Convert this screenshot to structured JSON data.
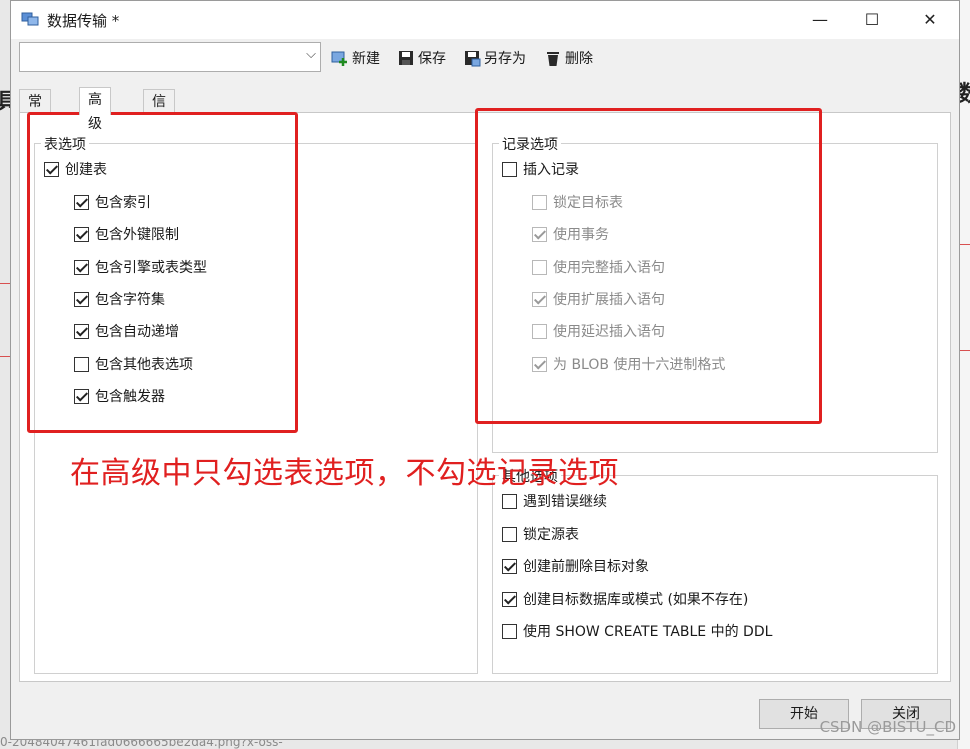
{
  "window": {
    "title": "数据传输 *",
    "minimize": "—",
    "maximize": "☐",
    "close": "✕"
  },
  "toolbar": {
    "profile_value": "",
    "new_label": "新建",
    "save_label": "保存",
    "saveas_label": "另存为",
    "delete_label": "删除"
  },
  "tabs": [
    {
      "label": "常规",
      "active": false
    },
    {
      "label": "高级",
      "active": true
    },
    {
      "label": "信息日志",
      "active": false
    }
  ],
  "table_options": {
    "title": "表选项",
    "create_table": {
      "label": "创建表",
      "checked": true
    },
    "items": [
      {
        "label": "包含索引",
        "checked": true
      },
      {
        "label": "包含外键限制",
        "checked": true
      },
      {
        "label": "包含引擎或表类型",
        "checked": true
      },
      {
        "label": "包含字符集",
        "checked": true
      },
      {
        "label": "包含自动递增",
        "checked": true
      },
      {
        "label": "包含其他表选项",
        "checked": false
      },
      {
        "label": "包含触发器",
        "checked": true
      }
    ]
  },
  "record_options": {
    "title": "记录选项",
    "insert_records": {
      "label": "插入记录",
      "checked": false
    },
    "items": [
      {
        "label": "锁定目标表",
        "checked": false
      },
      {
        "label": "使用事务",
        "checked": true
      },
      {
        "label": "使用完整插入语句",
        "checked": false
      },
      {
        "label": "使用扩展插入语句",
        "checked": true
      },
      {
        "label": "使用延迟插入语句",
        "checked": false
      },
      {
        "label": "为 BLOB 使用十六进制格式",
        "checked": true
      }
    ]
  },
  "other_options": {
    "title": "其他选项",
    "items": [
      {
        "label": "遇到错误继续",
        "checked": false
      },
      {
        "label": "锁定源表",
        "checked": false
      },
      {
        "label": "创建前删除目标对象",
        "checked": true
      },
      {
        "label": "创建目标数据库或模式 (如果不存在)",
        "checked": true
      },
      {
        "label": "使用 SHOW CREATE TABLE 中的 DDL",
        "checked": false
      }
    ]
  },
  "annotation": "在高级中只勾选表选项，不勾选记录选项",
  "buttons": {
    "start": "开始",
    "close": "关闭"
  },
  "watermark": "CSDN @BISTU_CD",
  "background_text": {
    "file_caption": "0-20484047461fad0666665be2da4.png?x-oss-",
    "edge_char_left": "具",
    "edge_char_right": "数"
  },
  "colors": {
    "annotation_red": "#e02020",
    "accent": "#1a6fc2"
  }
}
